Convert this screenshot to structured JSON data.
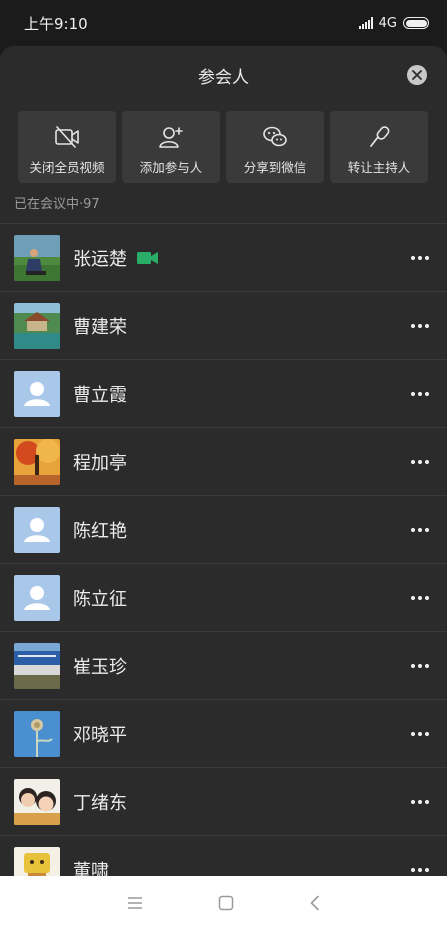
{
  "status": {
    "time": "上午9:10",
    "network": "4G"
  },
  "sheet": {
    "title": "参会人"
  },
  "actions": [
    {
      "label": "关闭全员视频",
      "icon": "video-off-icon"
    },
    {
      "label": "添加参与人",
      "icon": "add-person-icon"
    },
    {
      "label": "分享到微信",
      "icon": "wechat-icon"
    },
    {
      "label": "转让主持人",
      "icon": "microphone-icon"
    }
  ],
  "section": {
    "label": "已在会议中·97"
  },
  "participants": [
    {
      "name": "张运楚",
      "avatar": "photo-person-grass",
      "video": true
    },
    {
      "name": "曹建荣",
      "avatar": "photo-pavilion"
    },
    {
      "name": "曹立霞",
      "avatar": "default-avatar"
    },
    {
      "name": "程加亭",
      "avatar": "photo-autumn-tree"
    },
    {
      "name": "陈红艳",
      "avatar": "default-avatar"
    },
    {
      "name": "陈立征",
      "avatar": "default-avatar"
    },
    {
      "name": "崔玉珍",
      "avatar": "photo-banner"
    },
    {
      "name": "邓晓平",
      "avatar": "photo-flower-sky"
    },
    {
      "name": "丁绪东",
      "avatar": "photo-children"
    },
    {
      "name": "董啸",
      "avatar": "photo-cartoon"
    }
  ],
  "colors": {
    "accent_video": "#2aae67",
    "default_avatar_bg": "#a9c7e8"
  },
  "navbar": {
    "icons": [
      "menu-icon",
      "home-square-icon",
      "back-chevron-icon"
    ]
  }
}
